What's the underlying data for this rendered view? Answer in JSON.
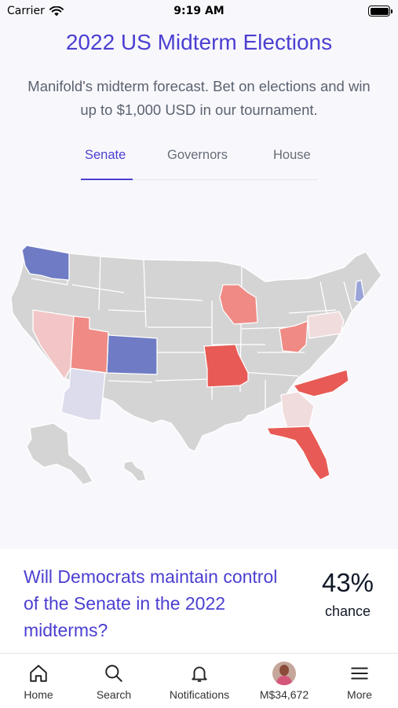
{
  "status_bar": {
    "carrier": "Carrier",
    "time": "9:19 AM"
  },
  "header": {
    "title": "2022 US Midterm Elections",
    "subtitle": "Manifold's midterm forecast. Bet on elections and win up to $1,000 USD in our tournament."
  },
  "tabs": [
    {
      "label": "Senate",
      "active": true
    },
    {
      "label": "Governors",
      "active": false
    },
    {
      "label": "House",
      "active": false
    }
  ],
  "map": {
    "colors": {
      "base": "#d4d4d4",
      "strong_red": "#e85a55",
      "mid_red": "#ef8a85",
      "light_red": "#f2c6c6",
      "faint_red": "#f1dcdd",
      "strong_blue": "#6f7bc4",
      "light_blue": "#9aa3d8",
      "faint_blue": "#dcdcec"
    },
    "highlighted_states": [
      {
        "state": "WA",
        "tint": "strong_blue"
      },
      {
        "state": "CO",
        "tint": "strong_blue"
      },
      {
        "state": "NH",
        "tint": "light_blue"
      },
      {
        "state": "AZ",
        "tint": "faint_blue"
      },
      {
        "state": "NV",
        "tint": "light_red"
      },
      {
        "state": "UT",
        "tint": "mid_red"
      },
      {
        "state": "WI",
        "tint": "mid_red"
      },
      {
        "state": "MO",
        "tint": "strong_red"
      },
      {
        "state": "OH",
        "tint": "mid_red"
      },
      {
        "state": "PA",
        "tint": "faint_red"
      },
      {
        "state": "NC",
        "tint": "strong_red"
      },
      {
        "state": "GA",
        "tint": "faint_red"
      },
      {
        "state": "FL",
        "tint": "strong_red"
      }
    ]
  },
  "market": {
    "question": "Will Democrats maintain control of the Senate in the 2022 midterms?",
    "probability": "43%",
    "probability_label": "chance"
  },
  "nav": {
    "home": "Home",
    "search": "Search",
    "notifications": "Notifications",
    "balance": "M$34,672",
    "more": "More"
  }
}
